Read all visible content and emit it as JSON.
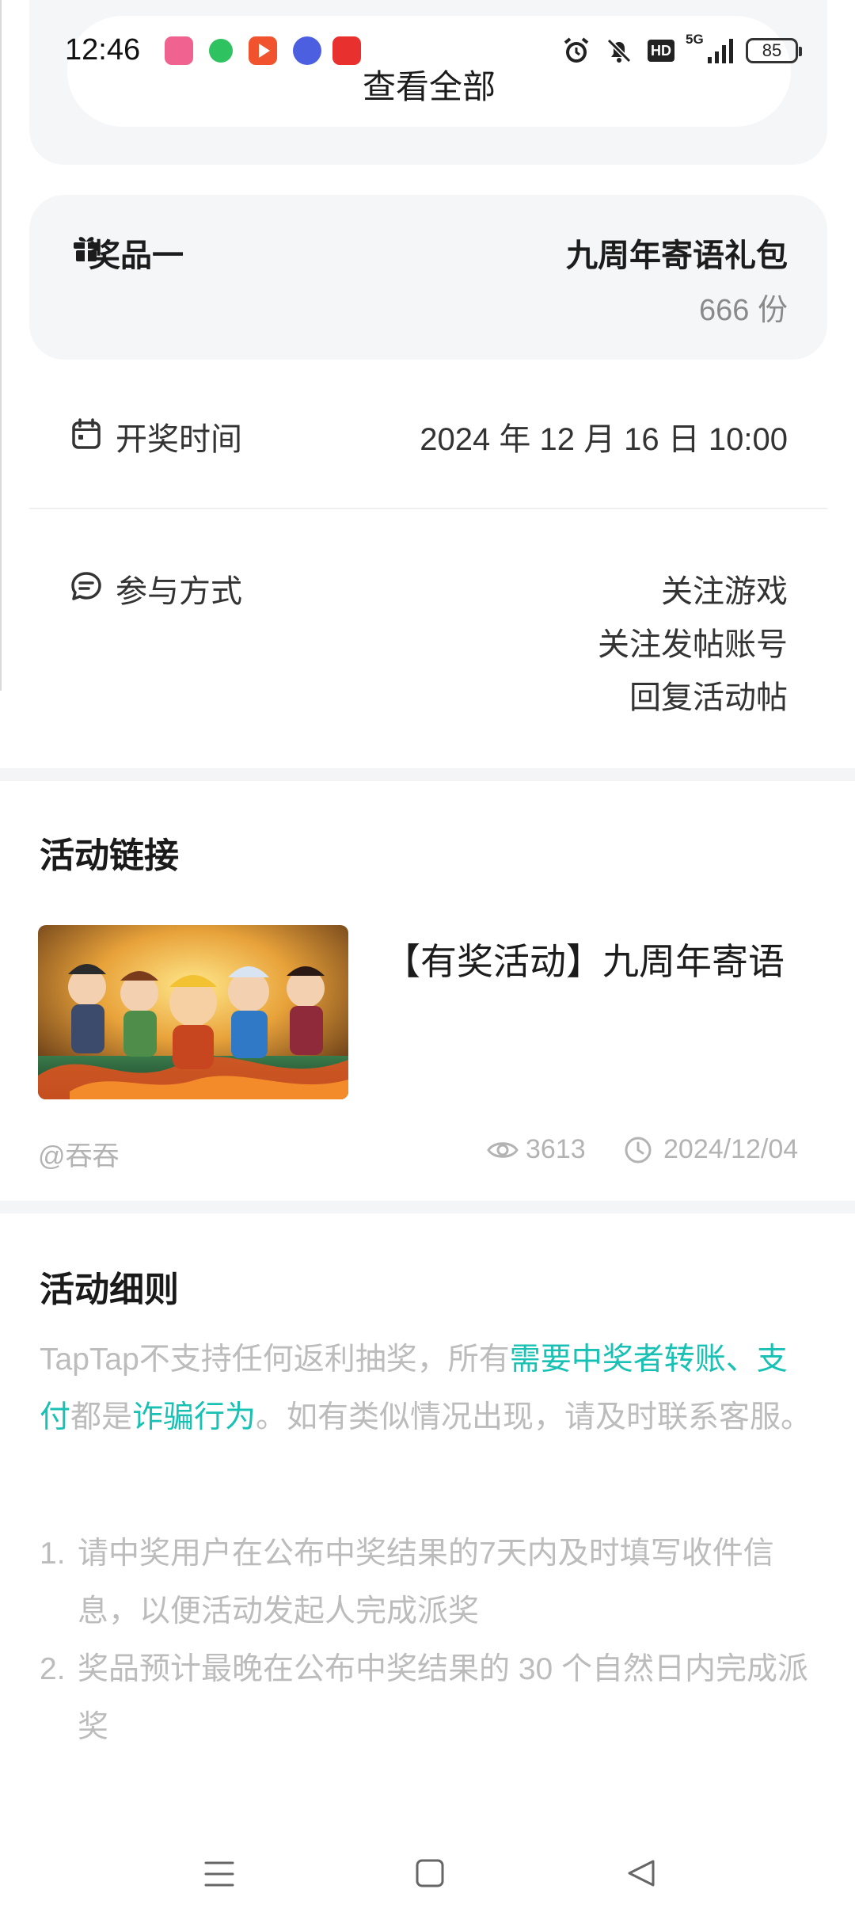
{
  "status_bar": {
    "time": "12:46",
    "battery": "85",
    "network": "5G",
    "hd_label": "HD",
    "app_icons": [
      {
        "name": "bilibili-icon",
        "color": "#f0628f"
      },
      {
        "name": "chat-bubble-icon",
        "color": "#2fc261"
      },
      {
        "name": "video-play-icon",
        "color": "#f0532d"
      },
      {
        "name": "tieba-icon",
        "color": "#4c5fe0"
      },
      {
        "name": "qidian-icon",
        "color": "#e8312f"
      }
    ]
  },
  "view_all": {
    "label": "查看全部"
  },
  "prize": {
    "label": "奖品一",
    "name": "九周年寄语礼包",
    "count": "666 份"
  },
  "draw_time": {
    "label": "开奖时间",
    "value": "2024 年 12 月 16 日 10:00"
  },
  "participation": {
    "label": "参与方式",
    "methods": [
      "关注游戏",
      "关注发帖账号",
      "回复活动帖"
    ]
  },
  "activity_link": {
    "section_title": "活动链接",
    "post_title": "【有奖活动】九周年寄语",
    "author": "@吞吞",
    "views": "3613",
    "date": "2024/12/04"
  },
  "rules": {
    "section_title": "活动细则",
    "warning_parts": {
      "p1": "TapTap不支持任何返利抽奖，所有",
      "h1": "需要中奖者转账、支付",
      "p2": "都是",
      "h2": "诈骗行为",
      "p3": "。如有类似情况出现，请及时联系客服。"
    },
    "items": [
      {
        "num": "1.",
        "text": "请中奖用户在公布中奖结果的7天内及时填写收件信息，以便活动发起人完成派奖"
      },
      {
        "num": "2.",
        "text": "奖品预计最晚在公布中奖结果的 30 个自然日内完成派奖"
      }
    ]
  },
  "colors": {
    "accent": "#18c1b4",
    "card_bg": "#f5f6f8",
    "muted_text": "#bcbcbc"
  }
}
